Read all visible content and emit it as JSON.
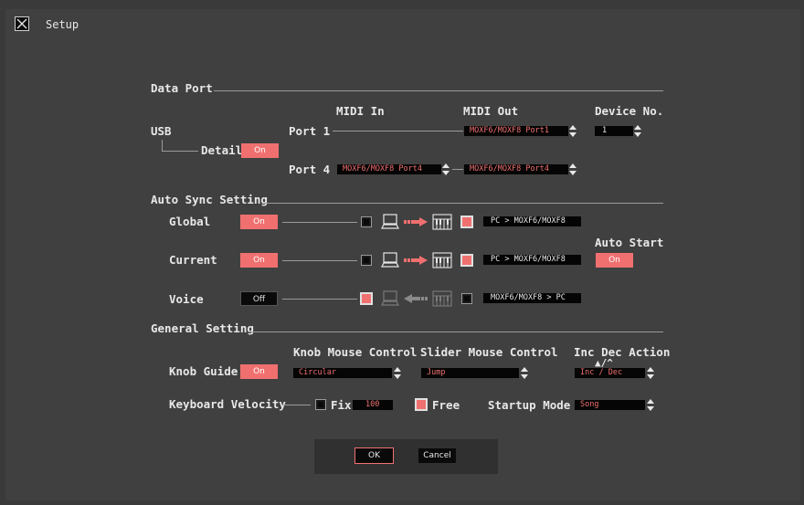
{
  "window": {
    "title": "Setup"
  },
  "data_port": {
    "section_title": "Data Port",
    "col_midi_in": "MIDI In",
    "col_midi_out": "MIDI Out",
    "col_device_no": "Device No.",
    "usb_label": "USB",
    "detail_label": "Detail",
    "detail_value": "On",
    "port1_label": "Port 1",
    "port1_midi_out": "MOXF6/MOXF8 Port1",
    "device_no_value": "1",
    "port4_label": "Port 4",
    "port4_midi_in": "MOXF6/MOXF8 Port4",
    "port4_midi_out": "MOXF6/MOXF8 Port4"
  },
  "auto_sync": {
    "section_title": "Auto Sync Setting",
    "rows": [
      {
        "label": "Global",
        "value": "On",
        "direction": "PC > MOXF6/MOXF8"
      },
      {
        "label": "Current",
        "value": "On",
        "direction": "PC > MOXF6/MOXF8"
      },
      {
        "label": "Voice",
        "value": "Off",
        "direction": "MOXF6/MOXF8 > PC"
      }
    ],
    "auto_start_label": "Auto Start",
    "auto_start_value": "On"
  },
  "general": {
    "section_title": "General Setting",
    "knob_guide_label": "Knob Guide",
    "knob_guide_value": "On",
    "knob_mouse_label": "Knob Mouse Control",
    "knob_mouse_value": "Circular",
    "slider_mouse_label": "Slider Mouse Control",
    "slider_mouse_value": "Jump",
    "inc_dec_label": "Inc Dec Action",
    "inc_dec_sub": "▲/^",
    "inc_dec_value": "Inc / Dec",
    "keyboard_velocity_label": "Keyboard Velocity",
    "fix_label": "Fix",
    "fix_value": "100",
    "free_label": "Free",
    "startup_mode_label": "Startup Mode",
    "startup_mode_value": "Song"
  },
  "footer": {
    "ok_label": "OK",
    "cancel_label": "Cancel"
  },
  "colors": {
    "accent": "#f07070",
    "background": "#404040"
  }
}
